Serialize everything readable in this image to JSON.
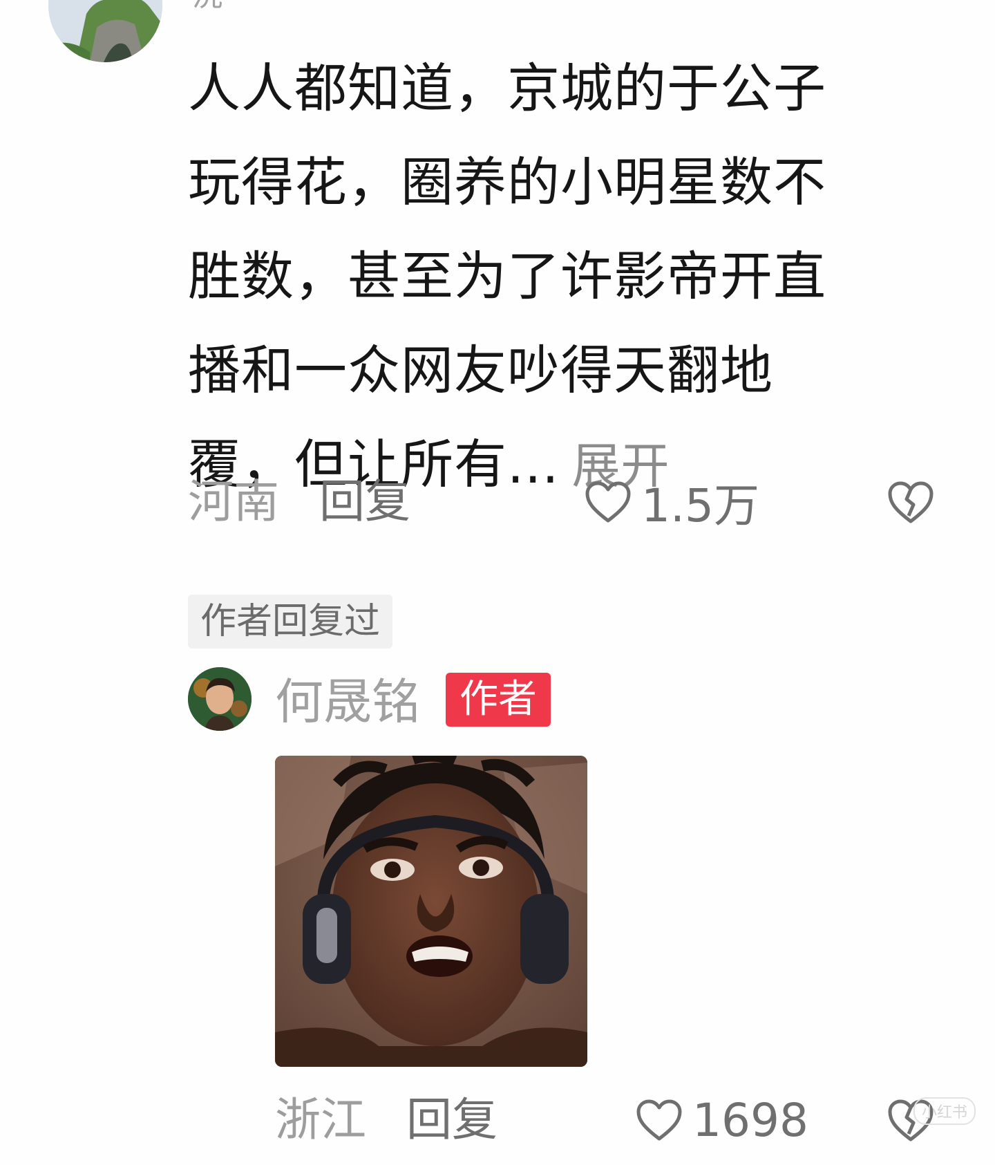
{
  "top_comment": {
    "username": "洸",
    "avatar": "landscape-avatar",
    "lines": [
      "人人都知道，京城的于公子",
      "玩得花，圈养的小明星数不",
      "胜数，甚至为了许影帝开直",
      "播和一众网友吵得天翻地",
      "覆，但让所有..."
    ],
    "expand_label": "展开",
    "location": "河南",
    "reply_label": "回复",
    "likes": "1.5万",
    "like_icon": "heart-outline-icon",
    "dislike_icon": "broken-heart-icon",
    "author_replied_label": "作者回复过"
  },
  "reply": {
    "username": "何晟铭",
    "badge": "作者",
    "avatar": "portrait-avatar",
    "image": "shocked-face-meme",
    "location": "浙江",
    "reply_label": "回复",
    "likes": "1698",
    "like_icon": "heart-outline-icon",
    "dislike_icon": "broken-heart-icon"
  },
  "watermark": "小红书",
  "colors": {
    "background": "#fefefe",
    "text_primary": "#161616",
    "text_secondary": "#9d9d9d",
    "badge_red": "#f0384b",
    "tag_bg": "#f1f1f1"
  }
}
